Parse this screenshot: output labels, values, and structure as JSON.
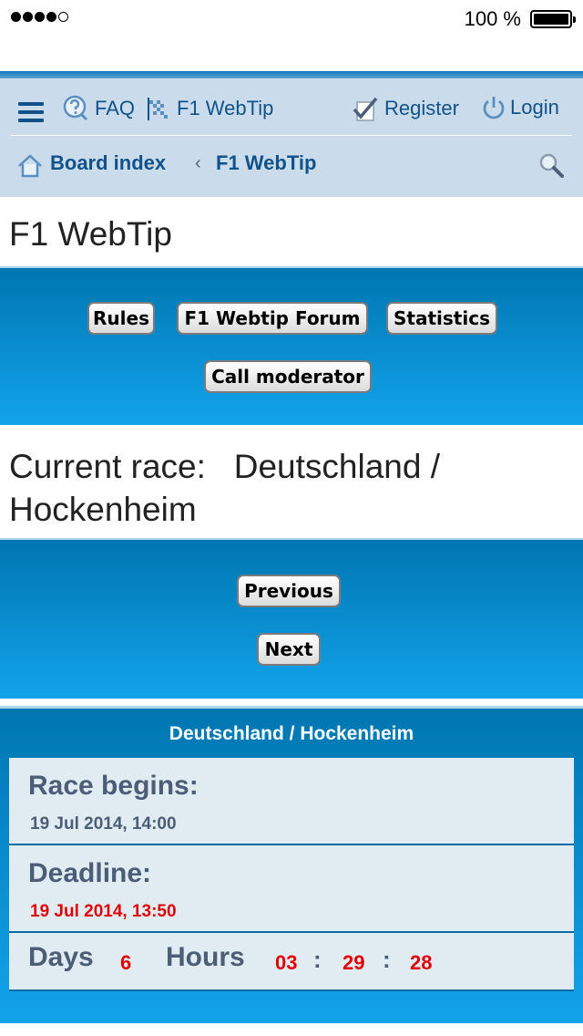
{
  "status_bar": {
    "signal_filled": 4,
    "signal_total": 5,
    "battery_percent": "100 %",
    "battery_level": 1.0
  },
  "nav": {
    "faq_label": "FAQ",
    "webtip_label": "F1 WebTip",
    "register_label": "Register",
    "login_label": "Login"
  },
  "breadcrumb": {
    "home_label": "Board index",
    "current_label": "F1 WebTip"
  },
  "page_title": "F1 WebTip",
  "menu_buttons": {
    "rules": "Rules",
    "forum": "F1 Webtip Forum",
    "statistics": "Statistics",
    "call_moderator": "Call moderator"
  },
  "current_race": {
    "text": "Current race:   Deutschland /\nHockenheim"
  },
  "race_nav": {
    "previous": "Previous",
    "next": "Next"
  },
  "race_info": {
    "header": "Deutschland / Hockenheim",
    "race_begins_label": "Race begins:",
    "race_begins_value": "19 Jul 2014, 14:00",
    "deadline_label": "Deadline:",
    "deadline_value": "19 Jul 2014, 13:50",
    "countdown": {
      "days_label": "Days",
      "days": "6",
      "hours_label": "Hours",
      "hh": "03",
      "mm": "29",
      "ss": "28",
      "separator": ":"
    }
  },
  "colors": {
    "link": "#105289",
    "panel_top": "#0076b1",
    "panel_bottom": "#12a3eb",
    "alert": "#e00000"
  }
}
